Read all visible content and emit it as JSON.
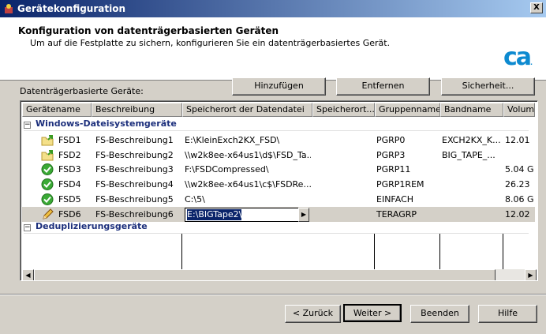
{
  "window": {
    "title": "Gerätekonfiguration",
    "close_label": "X"
  },
  "header": {
    "title": "Konfiguration von datenträgerbasierten Geräten",
    "subtitle": "Um auf die Festplatte zu sichern, konfigurieren Sie ein datenträgerbasiertes Gerät.",
    "logo": "ca"
  },
  "list_label": "Datenträgerbasierte Geräte:",
  "toolbar": {
    "add": "Hinzufügen",
    "remove": "Entfernen",
    "security": "Sicherheit..."
  },
  "columns": [
    "Gerätename",
    "Beschreibung",
    "Speicherort der Datendatei",
    "Speicherort...",
    "Gruppenname",
    "Bandname",
    "Volume"
  ],
  "groups": [
    {
      "label": "Windows-Dateisystemgeräte"
    },
    {
      "label": "Deduplizierungsgeräte"
    }
  ],
  "rows": [
    {
      "icon": "folder-arrow-icon",
      "name": "FSD1",
      "desc": "FS-Beschreibung1",
      "path": "E:\\KleinExch2KX_FSD\\",
      "loc2": "",
      "group": "PGRP0",
      "tape": "EXCH2KX_K...",
      "volume": "12.01"
    },
    {
      "icon": "folder-arrow-icon",
      "name": "FSD2",
      "desc": "FS-Beschreibung2",
      "path": "\\\\w2k8ee-x64us1\\d$\\FSD_Ta...",
      "loc2": "",
      "group": "PGRP3",
      "tape": "BIG_TAPE_...",
      "volume": ""
    },
    {
      "icon": "check-icon",
      "name": "FSD3",
      "desc": "FS-Beschreibung3",
      "path": "F:\\FSDCompressed\\",
      "loc2": "",
      "group": "PGRP11",
      "tape": "",
      "volume": "5.04 G"
    },
    {
      "icon": "check-icon",
      "name": "FSD4",
      "desc": "FS-Beschreibung4",
      "path": "\\\\w2k8ee-x64us1\\c$\\FSDRe...",
      "loc2": "",
      "group": "PGRP1REM",
      "tape": "",
      "volume": "26.23"
    },
    {
      "icon": "check-icon",
      "name": "FSD5",
      "desc": "FS-Beschreibung5",
      "path": "C:\\5\\",
      "loc2": "",
      "group": "EINFACH",
      "tape": "",
      "volume": "8.06 G"
    },
    {
      "icon": "pencil-icon",
      "name": "FSD6",
      "desc": "FS-Beschreibung6",
      "path": "E:\\BIGTape2\\",
      "loc2": "",
      "group": "TERAGRP",
      "tape": "",
      "volume": "12.02"
    }
  ],
  "footer": {
    "back": "< Zurück",
    "next": "Weiter >",
    "finish": "Beenden",
    "help": "Hilfe"
  },
  "colors": {
    "titlebar_start": "#0a246a",
    "titlebar_end": "#a6caf0",
    "group_text": "#1c2f7c",
    "logo": "#0d8ad0"
  }
}
